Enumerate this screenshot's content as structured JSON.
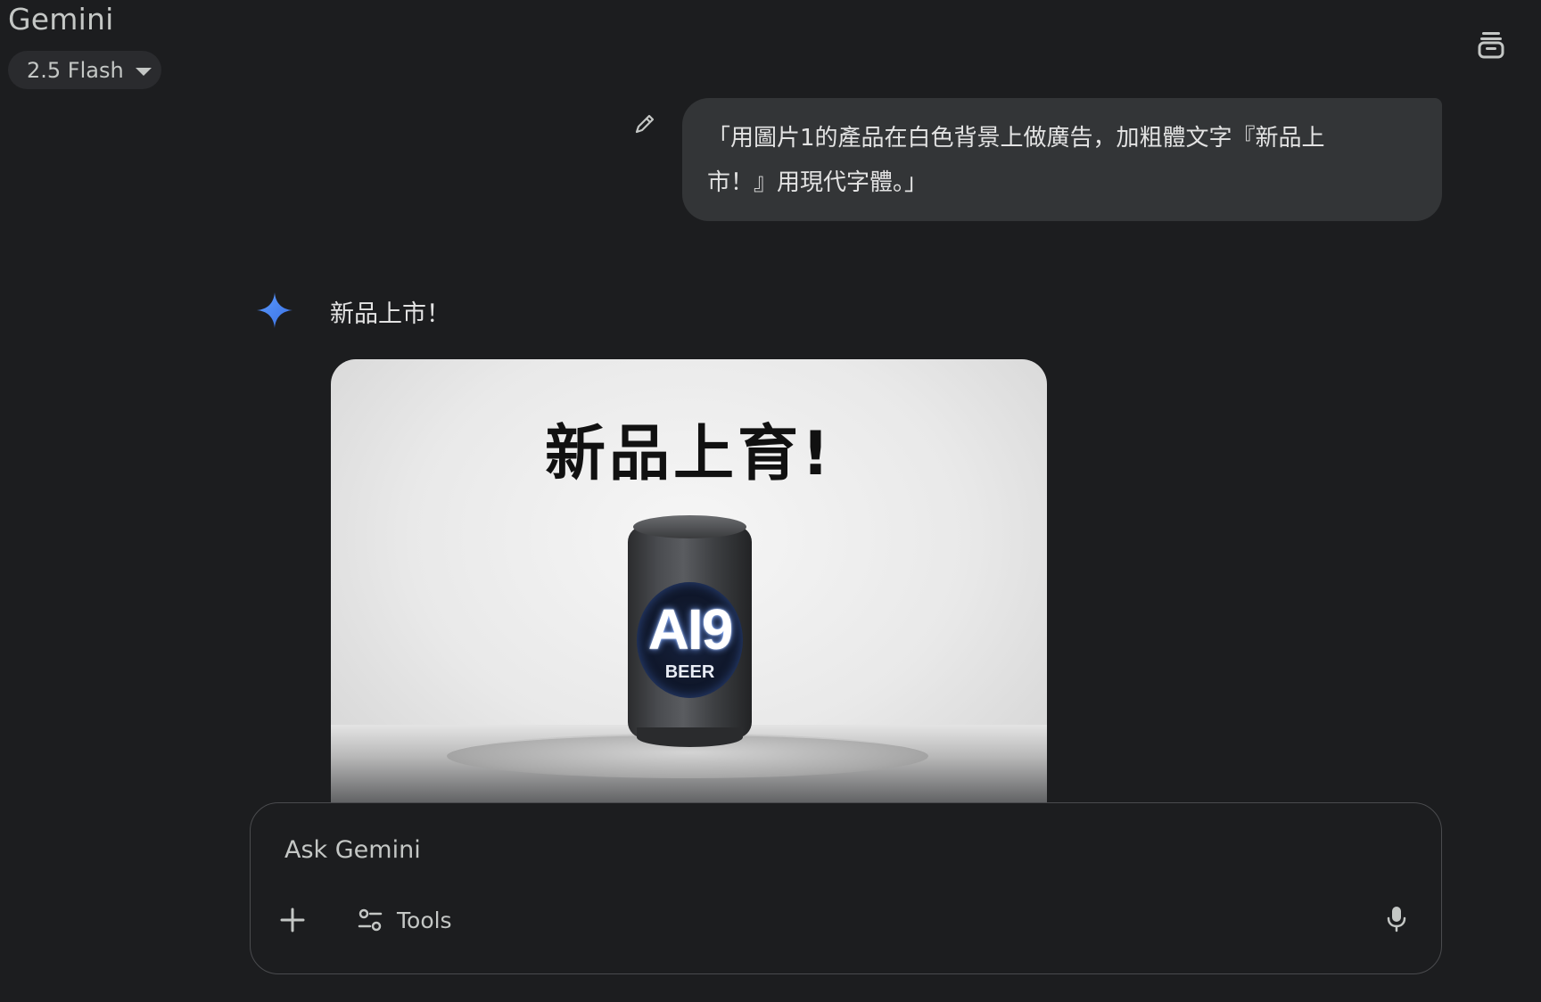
{
  "app": {
    "title": "Gemini",
    "model_label": "2.5 Flash"
  },
  "header": {
    "temp_chat_icon": "temporary-chat-icon"
  },
  "conversation": {
    "user_message_line1": "「用圖片1的產品在白色背景上做廣告，加粗體文字『新品上",
    "user_message_line2": "市！』用現代字體。」",
    "edit_icon": "pencil-icon",
    "response_text": "新品上市！",
    "generated_image": {
      "headline": "新品上育!",
      "can_brand": "AI9",
      "can_subtitle": "BEER"
    }
  },
  "composer": {
    "placeholder": "Ask Gemini",
    "tools_label": "Tools",
    "add_icon": "plus-icon",
    "tools_icon": "tune-icon",
    "mic_icon": "mic-icon"
  },
  "colors": {
    "background": "#1c1d1f",
    "bubble": "#333537",
    "accent_blue": "#4c8df6"
  }
}
